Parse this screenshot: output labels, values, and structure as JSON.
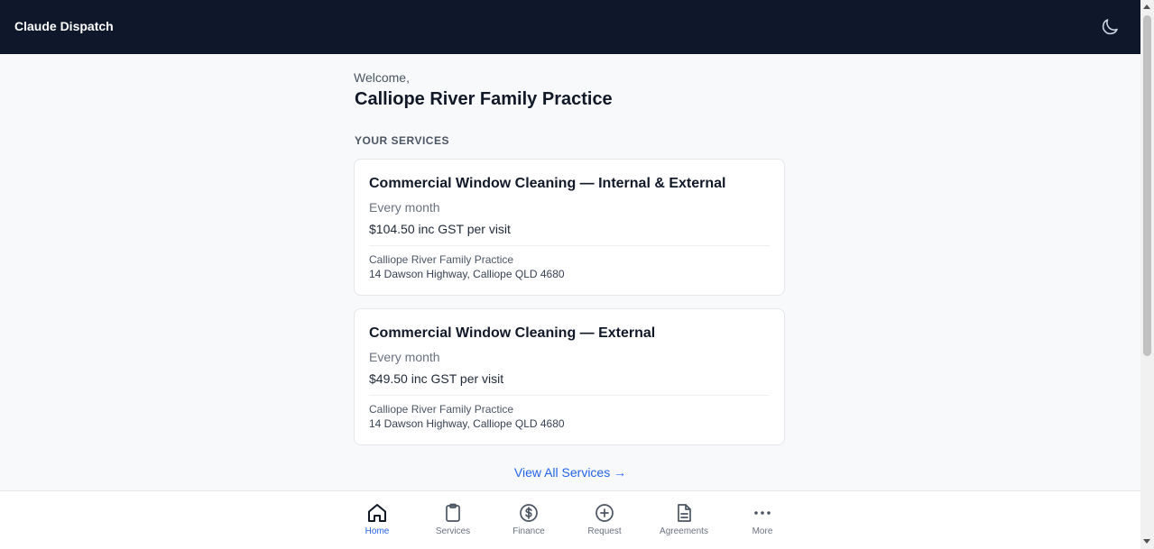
{
  "header": {
    "brand": "Claude Dispatch",
    "theme_toggle_icon": "moon-icon"
  },
  "colors": {
    "header_bg": "#0f172a",
    "accent": "#2563eb",
    "page_bg": "#f8f9fa"
  },
  "main": {
    "welcome": "Welcome,",
    "org_name": "Calliope River Family Practice",
    "section_label": "YOUR SERVICES",
    "services": [
      {
        "title": "Commercial Window Cleaning — Internal & External",
        "frequency": "Every month",
        "price": "$104.50 inc GST per visit",
        "site": "Calliope River Family Practice",
        "address": "14 Dawson Highway, Calliope QLD 4680"
      },
      {
        "title": "Commercial Window Cleaning — External",
        "frequency": "Every month",
        "price": "$49.50 inc GST per visit",
        "site": "Calliope River Family Practice",
        "address": "14 Dawson Highway, Calliope QLD 4680"
      }
    ],
    "view_all": "View All Services →"
  },
  "nav": {
    "items": [
      {
        "label": "Home",
        "icon": "home-icon",
        "active": true
      },
      {
        "label": "Services",
        "icon": "clipboard-icon",
        "active": false
      },
      {
        "label": "Finance",
        "icon": "dollar-icon",
        "active": false
      },
      {
        "label": "Request",
        "icon": "plus-circle-icon",
        "active": false
      },
      {
        "label": "Agreements",
        "icon": "document-icon",
        "active": false
      },
      {
        "label": "More",
        "icon": "more-dots-icon",
        "active": false
      }
    ]
  }
}
